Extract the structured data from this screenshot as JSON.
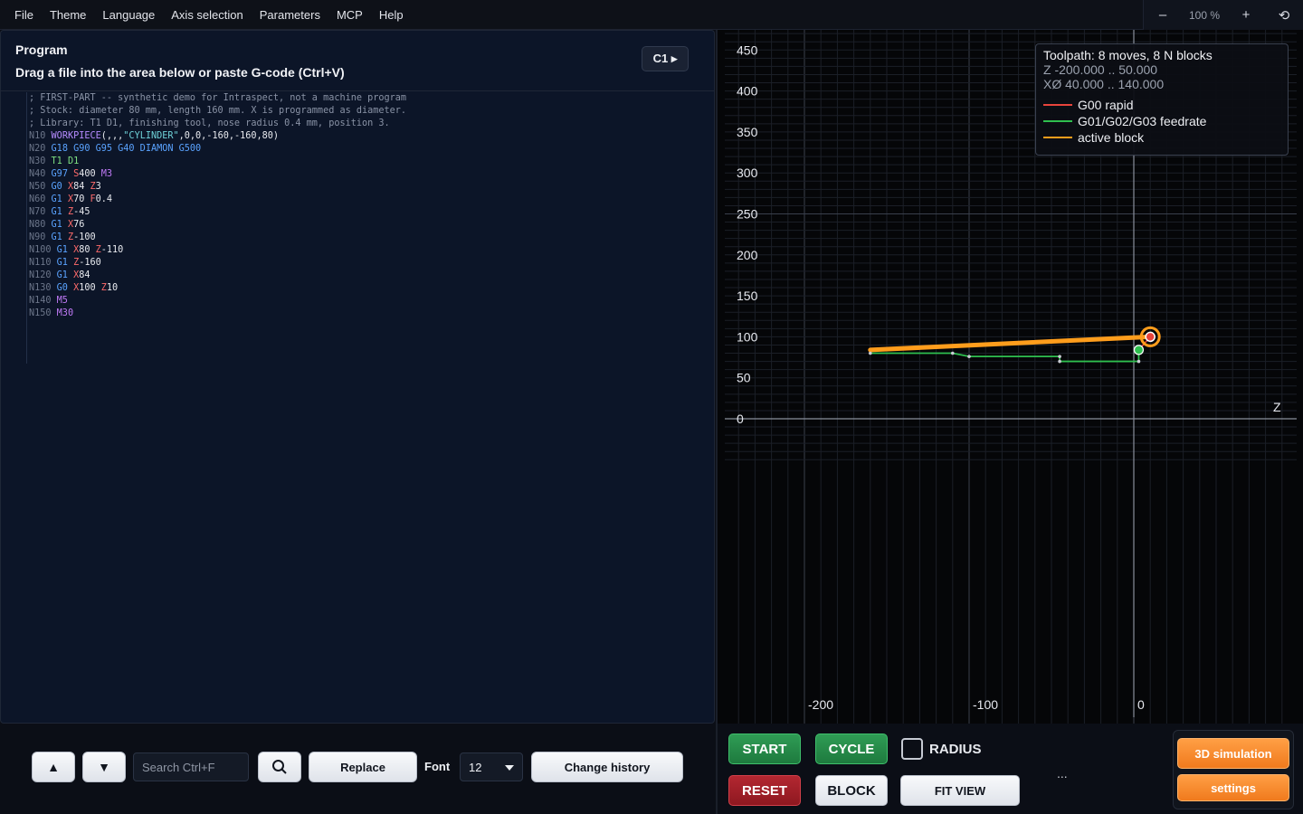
{
  "menu": [
    "File",
    "Theme",
    "Language",
    "Axis selection",
    "Parameters",
    "MCP",
    "Help"
  ],
  "zoom": {
    "minus": "–",
    "value": "100 %",
    "plus": "+",
    "reset": "⟲"
  },
  "program": {
    "title": "Program",
    "subtitle": "Drag a file into the area below or paste G-code (Ctrl+V)",
    "channel": "C1 ▸",
    "lines": [
      [
        [
          "; FIRST-PART -- synthetic demo for Intraspect, not a machine program",
          "comment"
        ]
      ],
      [
        [
          "; Stock: diameter 80 mm, length 160 mm. X is programmed as diameter.",
          "comment"
        ]
      ],
      [
        [
          "; Library: T1 D1, finishing tool, nose radius 0.4 mm, position 3.",
          "comment"
        ]
      ],
      [
        [
          "N10 ",
          "n"
        ],
        [
          "WORKPIECE",
          "w"
        ],
        [
          "(,,,",
          "v"
        ],
        [
          "\"CYLINDER\"",
          "s"
        ],
        [
          ",0,0,-160,-160,80)",
          "v"
        ]
      ],
      [
        [
          "N20 ",
          "n"
        ],
        [
          "G18 G90 G95 G40 DIAMON G500",
          "g"
        ]
      ],
      [
        [
          "N30 ",
          "n"
        ],
        [
          "T1 D1",
          "t"
        ]
      ],
      [
        [
          "N40 ",
          "n"
        ],
        [
          "G97 ",
          "g"
        ],
        [
          "S",
          "a"
        ],
        [
          "400 ",
          "v"
        ],
        [
          "M3",
          "m"
        ]
      ],
      [
        [
          "N50 ",
          "n"
        ],
        [
          "G0 ",
          "g"
        ],
        [
          "X",
          "a"
        ],
        [
          "84 ",
          "v"
        ],
        [
          "Z",
          "a"
        ],
        [
          "3",
          "v"
        ]
      ],
      [
        [
          "N60 ",
          "n"
        ],
        [
          "G1 ",
          "g"
        ],
        [
          "X",
          "a"
        ],
        [
          "70 ",
          "v"
        ],
        [
          "F",
          "a"
        ],
        [
          "0.4",
          "v"
        ]
      ],
      [
        [
          "N70 ",
          "n"
        ],
        [
          "G1 ",
          "g"
        ],
        [
          "Z",
          "a"
        ],
        [
          "-45",
          "v"
        ]
      ],
      [
        [
          "N80 ",
          "n"
        ],
        [
          "G1 ",
          "g"
        ],
        [
          "X",
          "a"
        ],
        [
          "76",
          "v"
        ]
      ],
      [
        [
          "N90 ",
          "n"
        ],
        [
          "G1 ",
          "g"
        ],
        [
          "Z",
          "a"
        ],
        [
          "-100",
          "v"
        ]
      ],
      [
        [
          "N100 ",
          "n"
        ],
        [
          "G1 ",
          "g"
        ],
        [
          "X",
          "a"
        ],
        [
          "80 ",
          "v"
        ],
        [
          "Z",
          "a"
        ],
        [
          "-110",
          "v"
        ]
      ],
      [
        [
          "N110 ",
          "n"
        ],
        [
          "G1 ",
          "g"
        ],
        [
          "Z",
          "a"
        ],
        [
          "-160",
          "v"
        ]
      ],
      [
        [
          "N120 ",
          "n"
        ],
        [
          "G1 ",
          "g"
        ],
        [
          "X",
          "a"
        ],
        [
          "84",
          "v"
        ]
      ],
      [
        [
          "N130 ",
          "n"
        ],
        [
          "G0 ",
          "g"
        ],
        [
          "X",
          "a"
        ],
        [
          "100 ",
          "v"
        ],
        [
          "Z",
          "a"
        ],
        [
          "10",
          "v"
        ]
      ],
      [
        [
          "N140 ",
          "n"
        ],
        [
          "M5",
          "m"
        ]
      ],
      [
        [
          "N150 ",
          "n"
        ],
        [
          "M30",
          "m"
        ]
      ]
    ]
  },
  "editor_toolbar": {
    "up": "▲",
    "down": "▼",
    "search_placeholder": "Search Ctrl+F",
    "replace": "Replace",
    "font_label": "Font",
    "font_value": "12",
    "history": "Change history"
  },
  "legend": {
    "title": "Toolpath: 8 moves, 8 N blocks",
    "z_range": "Z -200.000 .. 50.000",
    "x_range": "XØ 40.000 .. 140.000",
    "items": [
      {
        "label": "G00 rapid",
        "color": "#e8443c"
      },
      {
        "label": "G01/G02/G03 feedrate",
        "color": "#2fbf4f"
      },
      {
        "label": "active block",
        "color": "#ff9d1c"
      }
    ]
  },
  "chart_data": {
    "type": "line",
    "y_ticks": [
      "450",
      "400",
      "350",
      "300",
      "250",
      "200",
      "150",
      "100",
      "50",
      "0"
    ],
    "x_ticks": [
      "-200",
      "-100",
      "0"
    ],
    "axis_label_z": "Z",
    "ylim": [
      0,
      450
    ],
    "xlim": [
      -200,
      0
    ],
    "feed_path": [
      [
        -160,
        80
      ],
      [
        -110,
        80
      ],
      [
        -100,
        76
      ],
      [
        -45,
        76
      ],
      [
        -45,
        70
      ],
      [
        3,
        70
      ],
      [
        3,
        84
      ]
    ],
    "rapid_path": [
      [
        3,
        84
      ],
      [
        10,
        100
      ]
    ],
    "active_block": [
      [
        -160,
        84
      ],
      [
        10,
        100
      ]
    ],
    "current_point": [
      10,
      100
    ],
    "start_point": [
      3,
      84
    ]
  },
  "controls": {
    "start": "START",
    "cycle": "CYCLE",
    "radius": "RADIUS",
    "reset": "RESET",
    "block": "BLOCK",
    "fit": "FIT VIEW",
    "ellipsis": "...",
    "sim": "3D simulation",
    "settings": "settings"
  }
}
